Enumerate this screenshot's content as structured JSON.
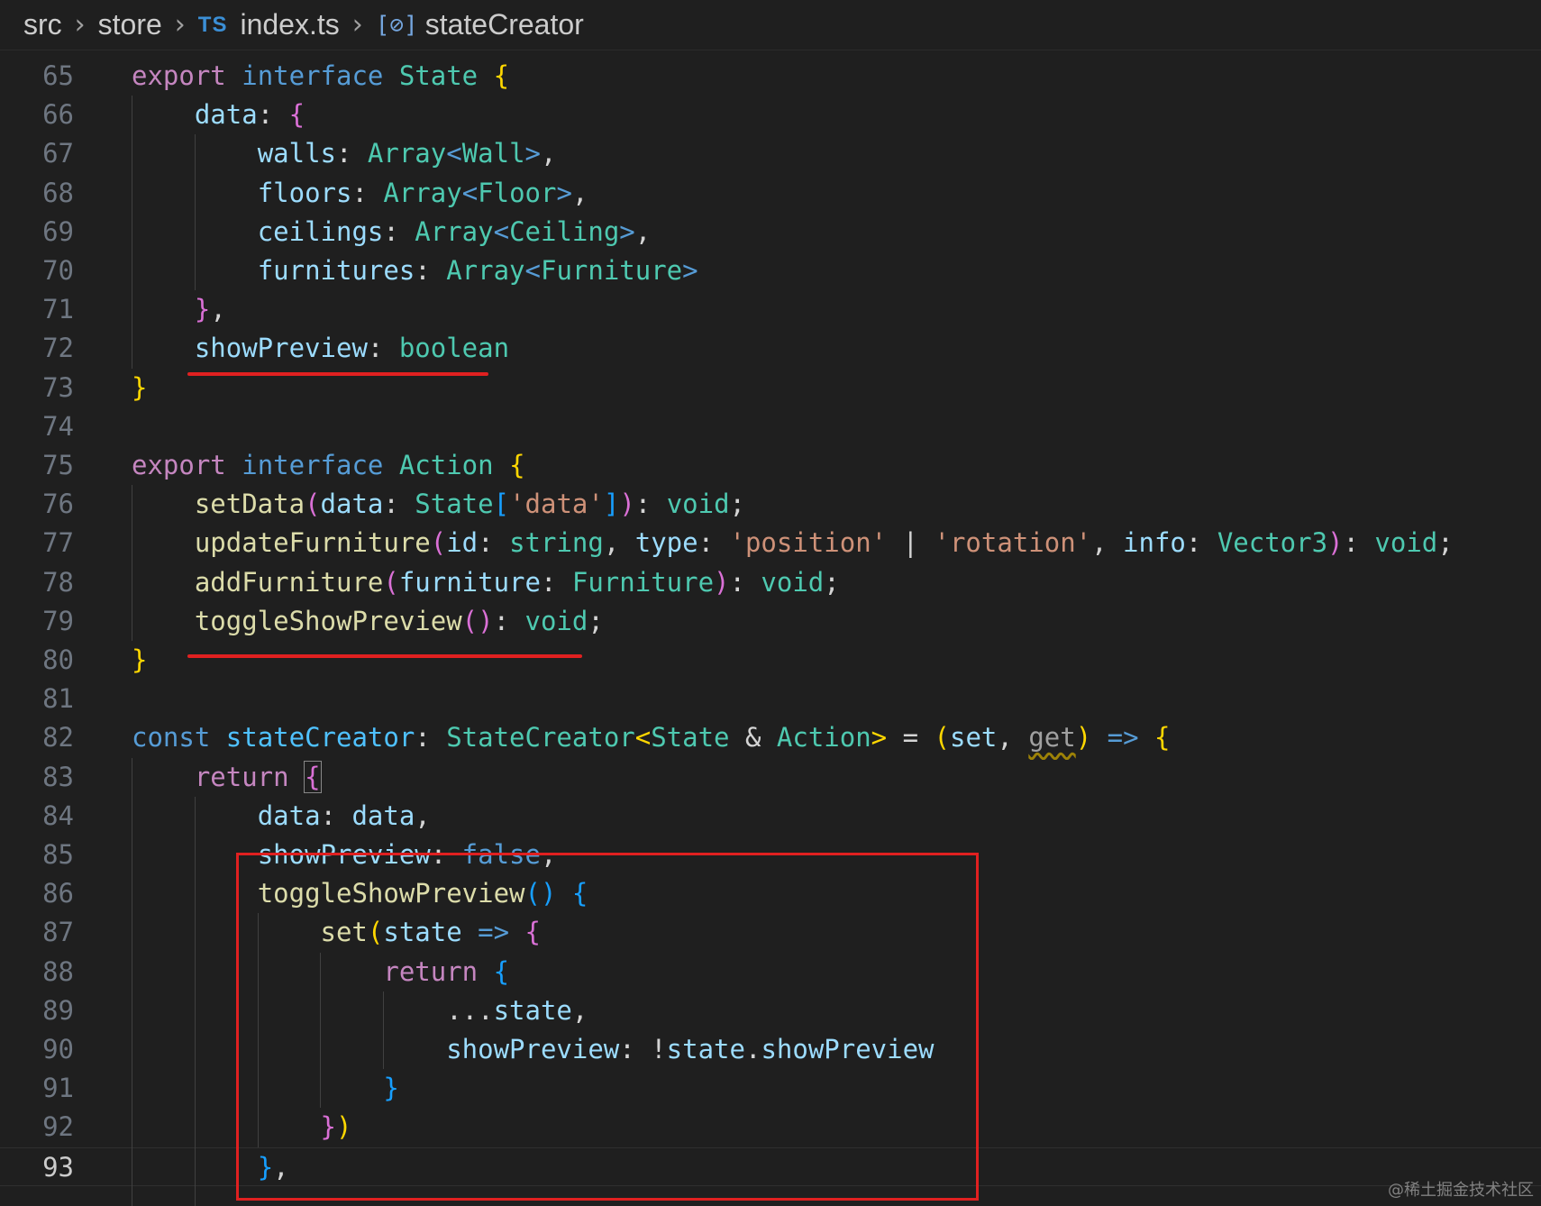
{
  "breadcrumb": {
    "items": [
      "src",
      "store",
      "index.ts",
      "stateCreator"
    ],
    "file_badge": "TS",
    "symbol_icon": "[⊘]"
  },
  "editor": {
    "current_line": 93,
    "lines": [
      {
        "n": "65",
        "tokens": [
          [
            "t-kw",
            "export"
          ],
          [
            "t-p",
            " "
          ],
          [
            "t-kwb",
            "interface"
          ],
          [
            "t-p",
            " "
          ],
          [
            "t-type",
            "State"
          ],
          [
            "t-p",
            " "
          ],
          [
            "t-b1",
            "{"
          ]
        ]
      },
      {
        "n": "66",
        "tokens": [
          [
            "t-p",
            "    "
          ],
          [
            "t-prop",
            "data"
          ],
          [
            "t-p",
            ": "
          ],
          [
            "t-b2",
            "{"
          ]
        ]
      },
      {
        "n": "67",
        "tokens": [
          [
            "t-p",
            "        "
          ],
          [
            "t-prop",
            "walls"
          ],
          [
            "t-p",
            ": "
          ],
          [
            "t-type",
            "Array"
          ],
          [
            "t-kwb",
            "<"
          ],
          [
            "t-type",
            "Wall"
          ],
          [
            "t-kwb",
            ">"
          ],
          [
            "t-p",
            ","
          ]
        ]
      },
      {
        "n": "68",
        "tokens": [
          [
            "t-p",
            "        "
          ],
          [
            "t-prop",
            "floors"
          ],
          [
            "t-p",
            ": "
          ],
          [
            "t-type",
            "Array"
          ],
          [
            "t-kwb",
            "<"
          ],
          [
            "t-type",
            "Floor"
          ],
          [
            "t-kwb",
            ">"
          ],
          [
            "t-p",
            ","
          ]
        ]
      },
      {
        "n": "69",
        "tokens": [
          [
            "t-p",
            "        "
          ],
          [
            "t-prop",
            "ceilings"
          ],
          [
            "t-p",
            ": "
          ],
          [
            "t-type",
            "Array"
          ],
          [
            "t-kwb",
            "<"
          ],
          [
            "t-type",
            "Ceiling"
          ],
          [
            "t-kwb",
            ">"
          ],
          [
            "t-p",
            ","
          ]
        ]
      },
      {
        "n": "70",
        "tokens": [
          [
            "t-p",
            "        "
          ],
          [
            "t-prop",
            "furnitures"
          ],
          [
            "t-p",
            ": "
          ],
          [
            "t-type",
            "Array"
          ],
          [
            "t-kwb",
            "<"
          ],
          [
            "t-type",
            "Furniture"
          ],
          [
            "t-kwb",
            ">"
          ]
        ]
      },
      {
        "n": "71",
        "tokens": [
          [
            "t-p",
            "    "
          ],
          [
            "t-b2",
            "}"
          ],
          [
            "t-p",
            ","
          ]
        ]
      },
      {
        "n": "72",
        "tokens": [
          [
            "t-p",
            "    "
          ],
          [
            "t-prop",
            "showPreview"
          ],
          [
            "t-p",
            ": "
          ],
          [
            "t-type",
            "boolean"
          ]
        ]
      },
      {
        "n": "73",
        "tokens": [
          [
            "t-b1",
            "}"
          ]
        ]
      },
      {
        "n": "74",
        "tokens": []
      },
      {
        "n": "75",
        "tokens": [
          [
            "t-kw",
            "export"
          ],
          [
            "t-p",
            " "
          ],
          [
            "t-kwb",
            "interface"
          ],
          [
            "t-p",
            " "
          ],
          [
            "t-type",
            "Action"
          ],
          [
            "t-p",
            " "
          ],
          [
            "t-b1",
            "{"
          ]
        ]
      },
      {
        "n": "76",
        "tokens": [
          [
            "t-p",
            "    "
          ],
          [
            "t-fn",
            "setData"
          ],
          [
            "t-b2",
            "("
          ],
          [
            "t-prop",
            "data"
          ],
          [
            "t-p",
            ": "
          ],
          [
            "t-type",
            "State"
          ],
          [
            "t-b3",
            "["
          ],
          [
            "t-str",
            "'data'"
          ],
          [
            "t-b3",
            "]"
          ],
          [
            "t-b2",
            ")"
          ],
          [
            "t-p",
            ": "
          ],
          [
            "t-type",
            "void"
          ],
          [
            "t-p",
            ";"
          ]
        ]
      },
      {
        "n": "77",
        "tokens": [
          [
            "t-p",
            "    "
          ],
          [
            "t-fn",
            "updateFurniture"
          ],
          [
            "t-b2",
            "("
          ],
          [
            "t-prop",
            "id"
          ],
          [
            "t-p",
            ": "
          ],
          [
            "t-type",
            "string"
          ],
          [
            "t-p",
            ", "
          ],
          [
            "t-prop",
            "type"
          ],
          [
            "t-p",
            ": "
          ],
          [
            "t-str",
            "'position'"
          ],
          [
            "t-p",
            " | "
          ],
          [
            "t-str",
            "'rotation'"
          ],
          [
            "t-p",
            ", "
          ],
          [
            "t-prop",
            "info"
          ],
          [
            "t-p",
            ": "
          ],
          [
            "t-type",
            "Vector3"
          ],
          [
            "t-b2",
            ")"
          ],
          [
            "t-p",
            ": "
          ],
          [
            "t-type",
            "void"
          ],
          [
            "t-p",
            ";"
          ]
        ]
      },
      {
        "n": "78",
        "tokens": [
          [
            "t-p",
            "    "
          ],
          [
            "t-fn",
            "addFurniture"
          ],
          [
            "t-b2",
            "("
          ],
          [
            "t-prop",
            "furniture"
          ],
          [
            "t-p",
            ": "
          ],
          [
            "t-type",
            "Furniture"
          ],
          [
            "t-b2",
            ")"
          ],
          [
            "t-p",
            ": "
          ],
          [
            "t-type",
            "void"
          ],
          [
            "t-p",
            ";"
          ]
        ]
      },
      {
        "n": "79",
        "tokens": [
          [
            "t-p",
            "    "
          ],
          [
            "t-fn",
            "toggleShowPreview"
          ],
          [
            "t-b2",
            "()"
          ],
          [
            "t-p",
            ": "
          ],
          [
            "t-type",
            "void"
          ],
          [
            "t-p",
            ";"
          ]
        ]
      },
      {
        "n": "80",
        "tokens": [
          [
            "t-b1",
            "}"
          ]
        ]
      },
      {
        "n": "81",
        "tokens": []
      },
      {
        "n": "82",
        "tokens": [
          [
            "t-kwb",
            "const"
          ],
          [
            "t-p",
            " "
          ],
          [
            "t-const",
            "stateCreator"
          ],
          [
            "t-p",
            ": "
          ],
          [
            "t-type",
            "StateCreator"
          ],
          [
            "t-b1",
            "<"
          ],
          [
            "t-type",
            "State"
          ],
          [
            "t-p",
            " & "
          ],
          [
            "t-type",
            "Action"
          ],
          [
            "t-b1",
            ">"
          ],
          [
            "t-p",
            " = "
          ],
          [
            "t-b1",
            "("
          ],
          [
            "t-prop",
            "set"
          ],
          [
            "t-p",
            ", "
          ],
          [
            "t-unused",
            "get"
          ],
          [
            "t-b1",
            ")"
          ],
          [
            "t-p",
            " "
          ],
          [
            "t-kwb",
            "=>"
          ],
          [
            "t-p",
            " "
          ],
          [
            "t-b1",
            "{"
          ]
        ]
      },
      {
        "n": "83",
        "tokens": [
          [
            "t-p",
            "    "
          ],
          [
            "t-kw",
            "return"
          ],
          [
            "t-p",
            " "
          ],
          [
            "t-b2 t-match",
            "{"
          ]
        ]
      },
      {
        "n": "84",
        "tokens": [
          [
            "t-p",
            "        "
          ],
          [
            "t-prop",
            "data"
          ],
          [
            "t-p",
            ": "
          ],
          [
            "t-prop",
            "data"
          ],
          [
            "t-p",
            ","
          ]
        ]
      },
      {
        "n": "85",
        "tokens": [
          [
            "t-p",
            "        "
          ],
          [
            "t-prop",
            "showPreview"
          ],
          [
            "t-p",
            ": "
          ],
          [
            "t-kwb",
            "false"
          ],
          [
            "t-p",
            ","
          ]
        ]
      },
      {
        "n": "86",
        "tokens": [
          [
            "t-p",
            "        "
          ],
          [
            "t-fn",
            "toggleShowPreview"
          ],
          [
            "t-b3",
            "()"
          ],
          [
            "t-p",
            " "
          ],
          [
            "t-b3",
            "{"
          ]
        ]
      },
      {
        "n": "87",
        "tokens": [
          [
            "t-p",
            "            "
          ],
          [
            "t-fn",
            "set"
          ],
          [
            "t-b1",
            "("
          ],
          [
            "t-prop",
            "state"
          ],
          [
            "t-p",
            " "
          ],
          [
            "t-kwb",
            "=>"
          ],
          [
            "t-p",
            " "
          ],
          [
            "t-b2",
            "{"
          ]
        ]
      },
      {
        "n": "88",
        "tokens": [
          [
            "t-p",
            "                "
          ],
          [
            "t-kw",
            "return"
          ],
          [
            "t-p",
            " "
          ],
          [
            "t-b3",
            "{"
          ]
        ]
      },
      {
        "n": "89",
        "tokens": [
          [
            "t-p",
            "                    ..."
          ],
          [
            "t-prop",
            "state"
          ],
          [
            "t-p",
            ","
          ]
        ]
      },
      {
        "n": "90",
        "tokens": [
          [
            "t-p",
            "                    "
          ],
          [
            "t-prop",
            "showPreview"
          ],
          [
            "t-p",
            ": !"
          ],
          [
            "t-prop",
            "state"
          ],
          [
            "t-p",
            "."
          ],
          [
            "t-prop",
            "showPreview"
          ]
        ]
      },
      {
        "n": "91",
        "tokens": [
          [
            "t-p",
            "                "
          ],
          [
            "t-b3",
            "}"
          ]
        ]
      },
      {
        "n": "92",
        "tokens": [
          [
            "t-p",
            "            "
          ],
          [
            "t-b2",
            "}"
          ],
          [
            "t-b1",
            ")"
          ]
        ]
      },
      {
        "n": "93",
        "tokens": [
          [
            "t-p",
            "        "
          ],
          [
            "t-b3",
            "}"
          ],
          [
            "t-p",
            ","
          ]
        ]
      }
    ]
  },
  "annotations": {
    "color": "#e02020"
  },
  "watermark": "@稀土掘金技术社区"
}
